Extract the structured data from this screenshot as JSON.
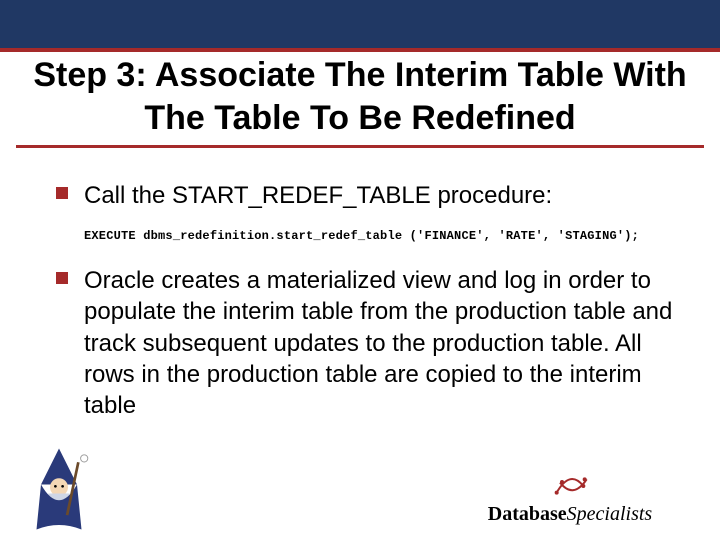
{
  "title": "Step 3: Associate The Interim Table With The Table To Be Redefined",
  "bullets": [
    {
      "text": "Call the START_REDEF_TABLE procedure:",
      "code": "EXECUTE dbms_redefinition.start_redef_table ('FINANCE', 'RATE', 'STAGING');"
    },
    {
      "text": "Oracle creates a materialized view and log in order to populate the interim table from the production table and track subsequent updates to the production table. All rows in the production table are copied to the interim table"
    }
  ],
  "logo": {
    "brand1": "Database",
    "brand2": "Specialists"
  },
  "icons": {
    "wizard": "wizard-icon",
    "swirl": "swirl-icon"
  }
}
